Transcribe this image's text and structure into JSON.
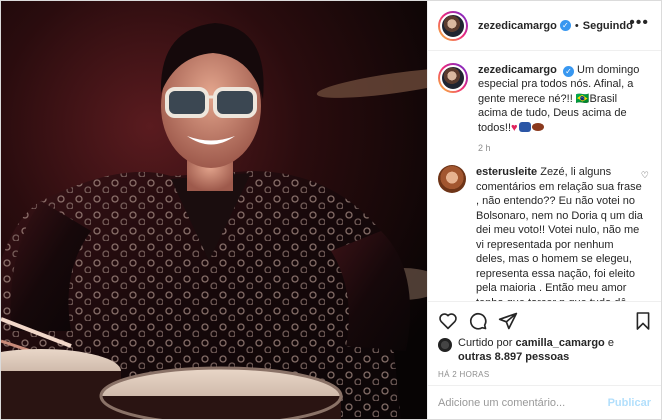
{
  "header": {
    "username": "zezedicamargo",
    "separator": "•",
    "follow_status": "Seguindo",
    "more": "•••"
  },
  "caption": {
    "username": "zezedicamargo",
    "text": "Um domingo especial pra todos nós. Afinal, a gente merece né?!! 🇧🇷Brasil acima de tudo, Deus acima de todos!!",
    "time": "2 h"
  },
  "comment": {
    "username": "esterusleite",
    "text": "Zezé, li alguns comentários em relação sua frase , não entendo?? Eu não votei no Bolsonaro, nem no Doria q um dia dei meu voto!! Votei nulo, não me vi representada por nenhum deles, mas o homem se elegeu, representa essa nação, foi eleito pela maioria . Então meu amor tenho que torcer p que tudo dê certo nesse governo🇧🇷 as pessoa precisam entender que ele é"
  },
  "likes": {
    "prefix": "Curtido por",
    "user": "camilla_camargo",
    "joiner": "e",
    "others": "outras 8.897 pessoas"
  },
  "timestamp": "HÁ 2 HORAS",
  "add_comment": {
    "placeholder": "Adicione um comentário...",
    "publish_label": "Publicar"
  },
  "icons": [
    "heart-icon",
    "comment-icon",
    "share-icon",
    "bookmark-icon",
    "verified-badge-icon",
    "more-options-icon"
  ],
  "colors": {
    "verified": "#3897f0",
    "publish_disabled": "#b2dffc",
    "muted": "#8e8e8e"
  }
}
